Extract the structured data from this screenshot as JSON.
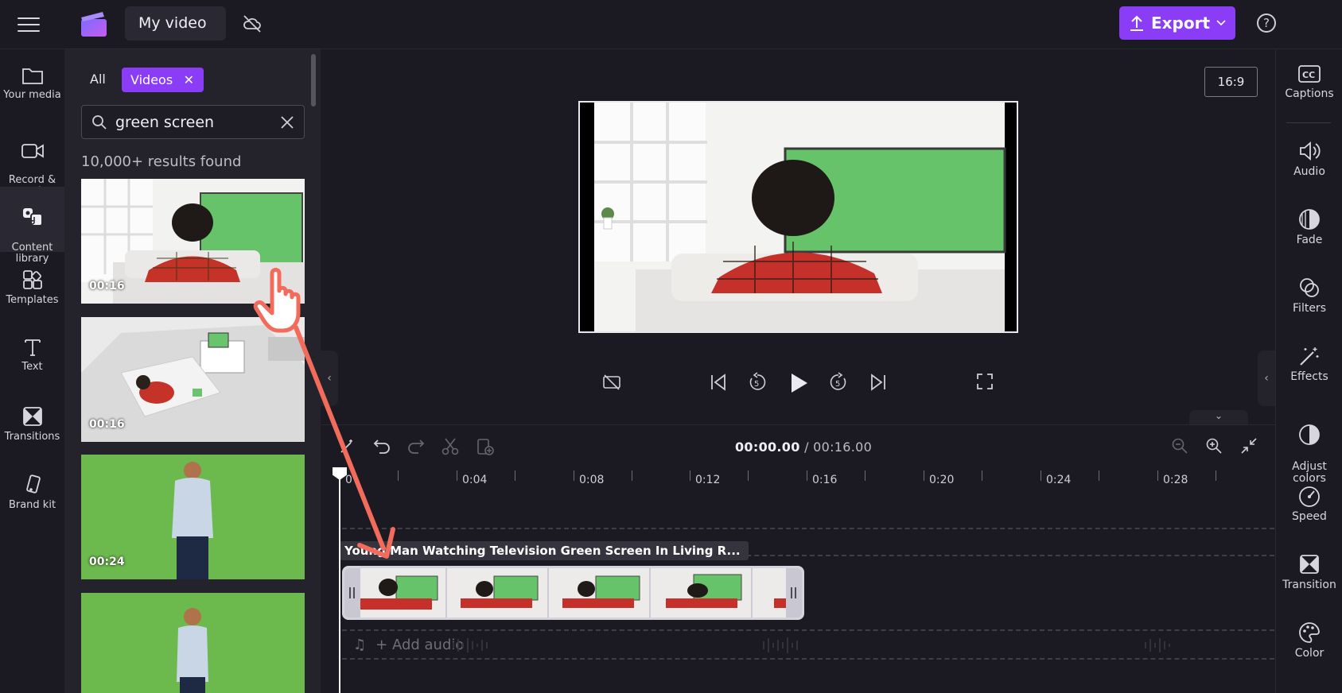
{
  "app": {
    "title": "My video",
    "export_label": "Export",
    "help_label": "?",
    "accent": "#8b3cf7"
  },
  "left_nav": [
    {
      "label": "Your media",
      "icon": "folder-icon"
    },
    {
      "label": "Record &\ncreate",
      "icon": "camera-icon"
    },
    {
      "label": "Content\nlibrary",
      "icon": "library-icon",
      "active": true
    },
    {
      "label": "Templates",
      "icon": "templates-icon"
    },
    {
      "label": "Text",
      "icon": "text-icon"
    },
    {
      "label": "Transitions",
      "icon": "transitions-icon"
    },
    {
      "label": "Brand kit",
      "icon": "brand-kit-icon"
    }
  ],
  "library": {
    "filter_all": "All",
    "filter_active": "Videos",
    "search_value": "green screen",
    "results_text": "10,000+ results found",
    "items": [
      {
        "duration": "00:16"
      },
      {
        "duration": "00:16"
      },
      {
        "duration": "00:24"
      },
      {
        "duration": ""
      }
    ]
  },
  "preview": {
    "aspect_ratio": "16:9"
  },
  "timeline": {
    "current_time": "00:00.00",
    "separator": " / ",
    "total_time": "00:16.00",
    "ruler_labels": [
      "0",
      "0:04",
      "0:08",
      "0:12",
      "0:16",
      "0:20",
      "0:24",
      "0:28"
    ],
    "clip_title": "Young Man Watching Television Green Screen In Living R...",
    "add_audio": "+ Add audio"
  },
  "right_nav": [
    {
      "label": "Captions",
      "icon": "captions-icon"
    },
    {
      "label": "Audio",
      "icon": "speaker-icon"
    },
    {
      "label": "Fade",
      "icon": "fade-icon"
    },
    {
      "label": "Filters",
      "icon": "filters-icon"
    },
    {
      "label": "Effects",
      "icon": "magic-wand-icon"
    },
    {
      "label": "Adjust\ncolors",
      "icon": "adjust-colors-icon"
    },
    {
      "label": "Speed",
      "icon": "speedometer-icon"
    },
    {
      "label": "Transition",
      "icon": "transition-icon"
    },
    {
      "label": "Color",
      "icon": "palette-icon"
    }
  ]
}
